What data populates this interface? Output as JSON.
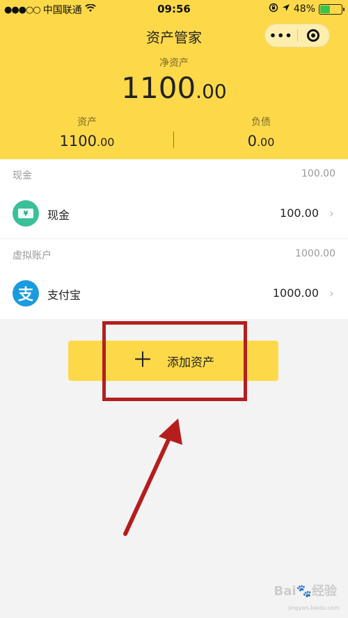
{
  "status_bar": {
    "signal_dots": "●●●○○",
    "carrier": "中国联通",
    "wifi_icon": "wifi-icon",
    "time": "09:56",
    "battery": "48%",
    "battery_level": 0.48,
    "battery_color": "#3ac44a"
  },
  "nav": {
    "title": "资产管家",
    "more_label": "•••"
  },
  "summary": {
    "net_label": "净资产",
    "net_int": "1100",
    "net_dec": ".00",
    "assets_label": "资产",
    "assets_int": "1100",
    "assets_dec": ".00",
    "liabilities_label": "负债",
    "liabilities_int": "0",
    "liabilities_dec": ".00"
  },
  "groups": [
    {
      "label": "现金",
      "total": "100.00",
      "items": [
        {
          "icon": "cash-icon",
          "icon_glyph": "¥",
          "label": "现金",
          "value": "100.00"
        }
      ]
    },
    {
      "label": "虚拟账户",
      "total": "1000.00",
      "items": [
        {
          "icon": "alipay-icon",
          "icon_glyph": "支",
          "label": "支付宝",
          "value": "1000.00"
        }
      ]
    }
  ],
  "add_button": {
    "icon": "plus-icon",
    "label": "添加资产"
  },
  "colors": {
    "header": "#fdd94a",
    "annotation_red": "#b51e1e"
  },
  "watermark": {
    "brand": "Bai🐾经验",
    "url": "jingyan.baidu.com"
  }
}
